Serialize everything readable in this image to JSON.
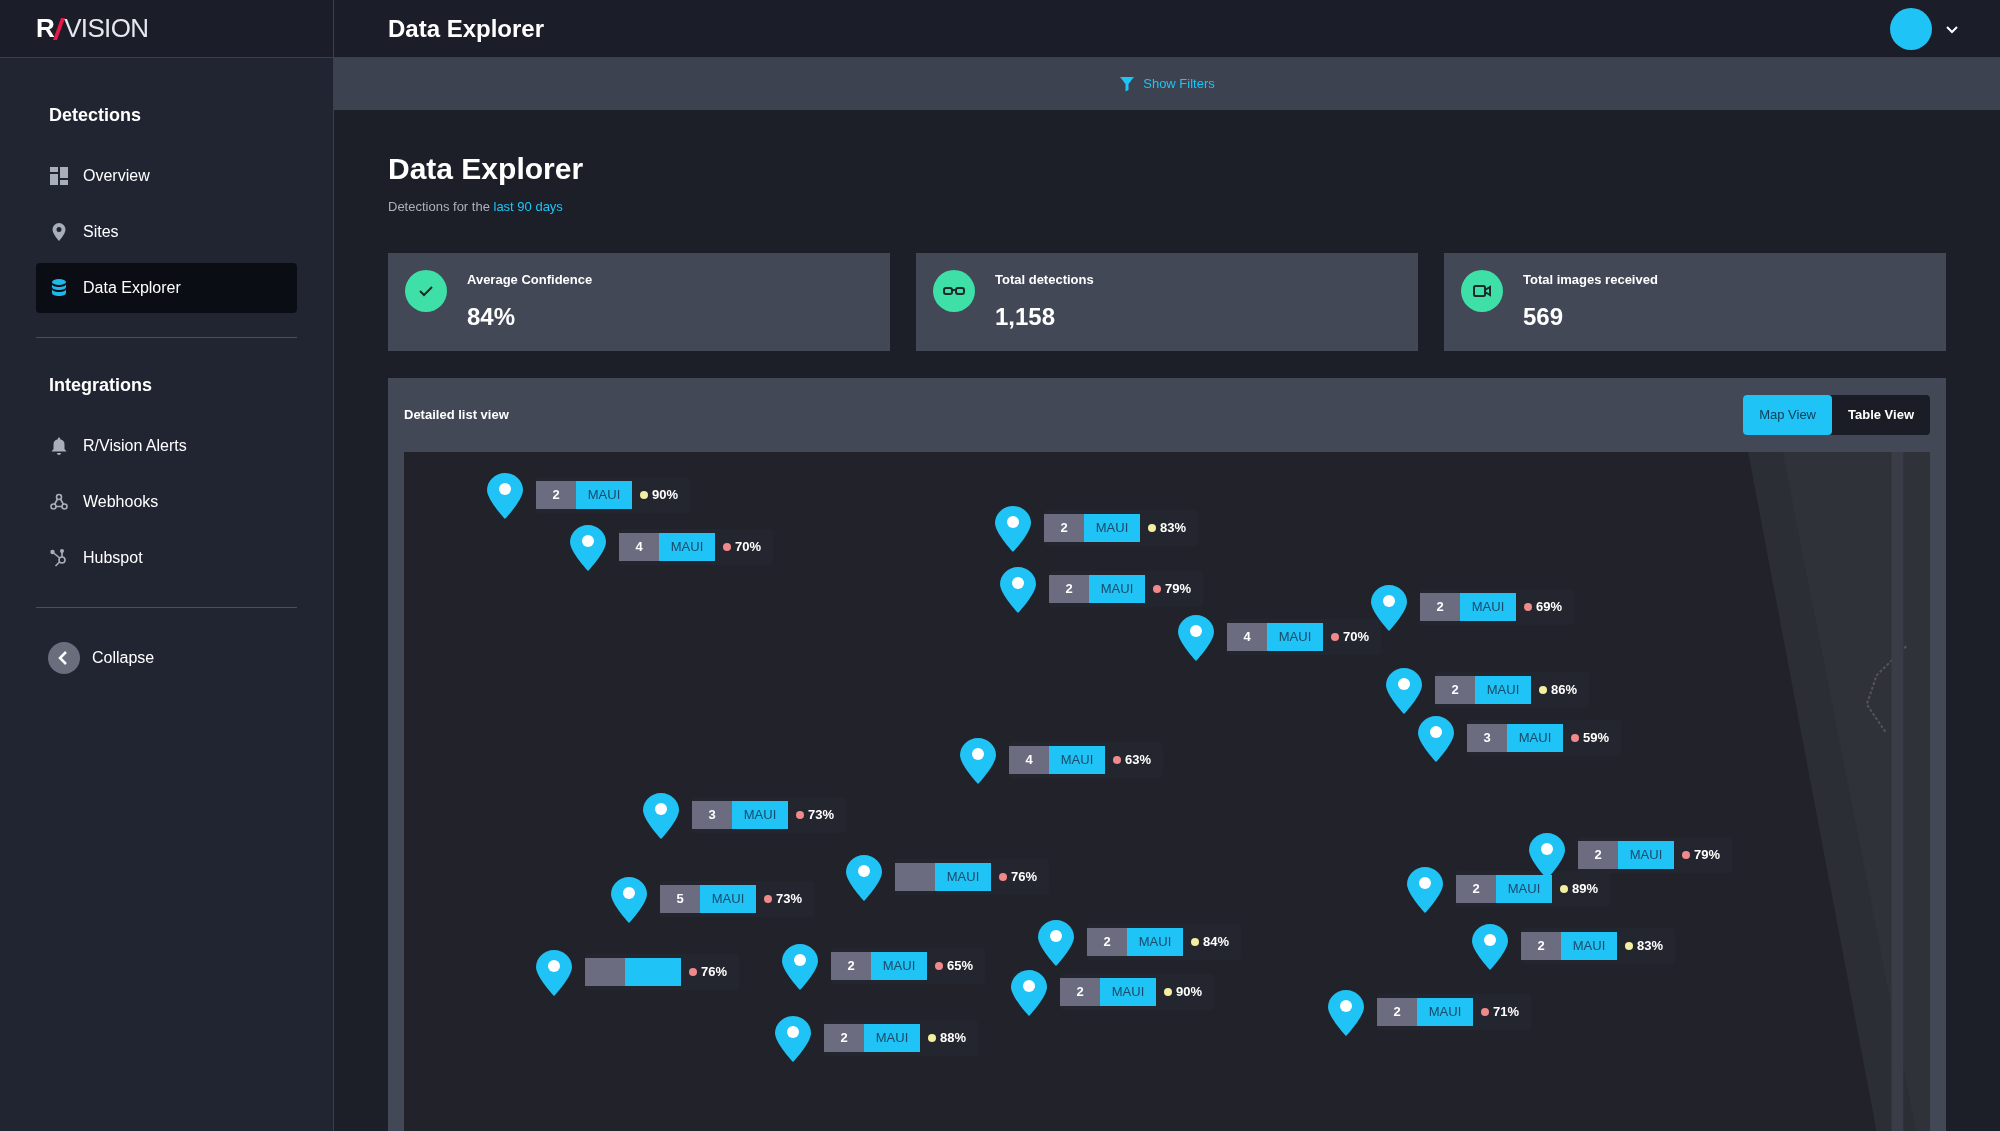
{
  "logo": {
    "left": "R",
    "right": "VISION"
  },
  "header": {
    "title": "Data Explorer"
  },
  "filter_bar": {
    "label": "Show Filters"
  },
  "sidebar": {
    "sections": [
      {
        "title": "Detections",
        "items": [
          {
            "label": "Overview",
            "kind": "overview",
            "selected": false
          },
          {
            "label": "Sites",
            "kind": "sites",
            "selected": false
          },
          {
            "label": "Data Explorer",
            "kind": "data",
            "selected": true
          }
        ]
      },
      {
        "title": "Integrations",
        "items": [
          {
            "label": "R/Vision Alerts",
            "kind": "alerts",
            "selected": false
          },
          {
            "label": "Webhooks",
            "kind": "webhooks",
            "selected": false
          },
          {
            "label": "Hubspot",
            "kind": "hubspot",
            "selected": false
          }
        ]
      }
    ],
    "collapse": "Collapse"
  },
  "page": {
    "title": "Data Explorer",
    "subtitle": "Detections for the ",
    "subtitle_link": "last 90 days"
  },
  "stats": [
    {
      "kind": "check",
      "label": "Average Confidence",
      "value": "84%"
    },
    {
      "kind": "glasses",
      "label": "Total detections",
      "value": "1,158"
    },
    {
      "kind": "camera",
      "label": "Total images received",
      "value": "569"
    }
  ],
  "panel": {
    "title": "Detailed list view",
    "views": [
      {
        "label": "Map View",
        "selected": true
      },
      {
        "label": "Table View",
        "selected": false
      }
    ]
  },
  "markers": [
    {
      "count": "2",
      "region": "MAUI",
      "confidence": "90%",
      "color": "#f3eea0"
    },
    {
      "count": "4",
      "region": "MAUI",
      "confidence": "70%",
      "color": "#f08a8a"
    },
    {
      "count": "2",
      "region": "MAUI",
      "confidence": "83%",
      "color": "#f3eea0"
    },
    {
      "count": "2",
      "region": "MAUI",
      "confidence": "79%",
      "color": "#f08a8a"
    },
    {
      "count": "4",
      "region": "MAUI",
      "confidence": "70%",
      "color": "#f08a8a"
    },
    {
      "count": "2",
      "region": "MAUI",
      "confidence": "69%",
      "color": "#f08a8a"
    },
    {
      "count": "2",
      "region": "MAUI",
      "confidence": "86%",
      "color": "#f3eea0"
    },
    {
      "count": "3",
      "region": "MAUI",
      "confidence": "59%",
      "color": "#f08a8a"
    },
    {
      "count": "4",
      "region": "MAUI",
      "confidence": "63%",
      "color": "#f08a8a"
    },
    {
      "count": "3",
      "region": "MAUI",
      "confidence": "73%",
      "color": "#f08a8a"
    },
    {
      "count": "2",
      "region": "MAUI",
      "confidence": "79%",
      "color": "#f08a8a"
    },
    {
      "count": "2",
      "region": "MAUI",
      "confidence": "89%",
      "color": "#f3eea0"
    },
    {
      "count": "5",
      "region": "MAUI",
      "confidence": "73%",
      "color": "#f08a8a"
    },
    {
      "region": "MAUI",
      "confidence": "76%",
      "color": "#f08a8a"
    },
    {
      "confidence": "76%",
      "color": "#f08a8a"
    },
    {
      "count": "2",
      "region": "MAUI",
      "confidence": "84%",
      "color": "#f3eea0"
    },
    {
      "count": "2",
      "region": "MAUI",
      "confidence": "65%",
      "color": "#f08a8a"
    },
    {
      "count": "2",
      "region": "MAUI",
      "confidence": "90%",
      "color": "#f3eea0"
    },
    {
      "count": "2",
      "region": "MAUI",
      "confidence": "83%",
      "color": "#f3eea0"
    },
    {
      "count": "2",
      "region": "MAUI",
      "confidence": "88%",
      "color": "#f3eea0"
    },
    {
      "count": "2",
      "region": "MAUI",
      "confidence": "71%",
      "color": "#f08a8a"
    }
  ]
}
